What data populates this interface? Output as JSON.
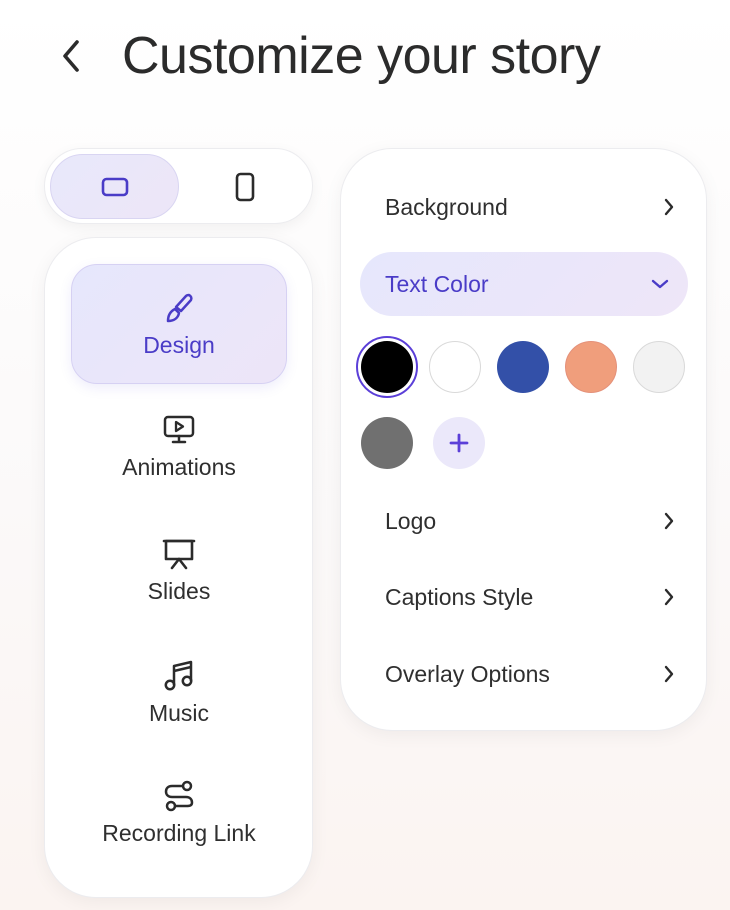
{
  "header": {
    "title": "Customize your story",
    "back_icon": "chevron-left-icon"
  },
  "orientation_toggle": {
    "selected": "landscape",
    "options": [
      {
        "id": "landscape",
        "icon": "landscape-rectangle-icon"
      },
      {
        "id": "portrait",
        "icon": "portrait-rectangle-icon"
      }
    ]
  },
  "nav": {
    "active": "Design",
    "items": [
      {
        "label": "Design",
        "icon": "paintbrush-icon"
      },
      {
        "label": "Animations",
        "icon": "monitor-play-icon"
      },
      {
        "label": "Slides",
        "icon": "presentation-board-icon"
      },
      {
        "label": "Music",
        "icon": "music-note-icon"
      },
      {
        "label": "Recording Link",
        "icon": "route-link-icon"
      }
    ]
  },
  "settings": {
    "background_label": "Background",
    "text_color_label": "Text Color",
    "logo_label": "Logo",
    "captions_style_label": "Captions Style",
    "overlay_options_label": "Overlay Options",
    "text_color": {
      "selected": "#000000",
      "swatches": [
        "#000000",
        "#ffffff",
        "#3350a8",
        "#f09e7c",
        "#f2f2f2",
        "#707070"
      ],
      "add_icon": "plus-icon"
    }
  },
  "colors": {
    "accent": "#5b3fd8",
    "accent_text": "#4a3cc7",
    "active_bg": "#e8e7fb"
  }
}
